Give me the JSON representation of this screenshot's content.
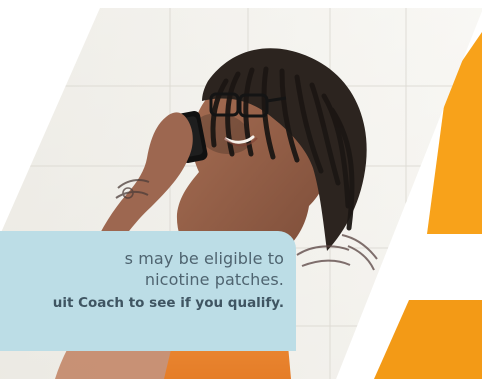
{
  "ad": {
    "message_line_1": "s may be eligible to",
    "message_line_2": "nicotine patches.",
    "message_line_3": "uit Coach to see if you qualify."
  },
  "colors": {
    "message_box": "#bcdde6",
    "orange_primary": "#f8a21a",
    "orange_secondary": "#f39a16",
    "wall_light": "#f3f1ec",
    "tank_top": "#f08a30"
  },
  "icons": {
    "phone": "phone-icon",
    "tattoo": "tattoo-icon"
  }
}
